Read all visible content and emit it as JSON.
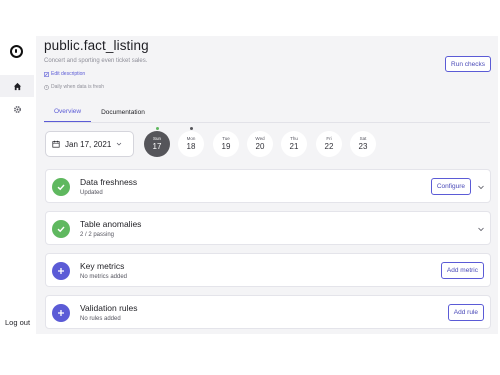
{
  "sidebar": {
    "logout_label": "Log out"
  },
  "header": {
    "title": "public.fact_listing",
    "description": "Concert and sporting even ticket sales.",
    "edit_label": "Edit description",
    "schedule": "Daily when data is fresh",
    "run_checks_label": "Run checks"
  },
  "tabs": [
    {
      "label": "Overview",
      "active": true
    },
    {
      "label": "Documentation",
      "active": false
    }
  ],
  "date_picker": {
    "value": "Jan 17, 2021"
  },
  "days": [
    {
      "name": "Sun",
      "num": "17",
      "selected": true,
      "marker": "#5fb85f"
    },
    {
      "name": "Mon",
      "num": "18",
      "selected": false,
      "marker": "#55555a"
    },
    {
      "name": "Tue",
      "num": "19",
      "selected": false
    },
    {
      "name": "Wed",
      "num": "20",
      "selected": false
    },
    {
      "name": "Thu",
      "num": "21",
      "selected": false
    },
    {
      "name": "Fri",
      "num": "22",
      "selected": false
    },
    {
      "name": "Sat",
      "num": "23",
      "selected": false
    }
  ],
  "cards": [
    {
      "title": "Data freshness",
      "subtitle": "Updated",
      "status": "ok",
      "button": "Configure",
      "expandable": true
    },
    {
      "title": "Table anomalies",
      "subtitle": "2 / 2 passing",
      "status": "ok",
      "button": "",
      "expandable": true
    },
    {
      "title": "Key metrics",
      "subtitle": "No metrics added",
      "status": "add",
      "button": "Add metric",
      "expandable": false
    },
    {
      "title": "Validation rules",
      "subtitle": "No rules added",
      "status": "add",
      "button": "Add rule",
      "expandable": false
    }
  ],
  "colors": {
    "accent": "#5b5bd6",
    "success": "#5fb85f",
    "background": "#f4f4f6"
  }
}
